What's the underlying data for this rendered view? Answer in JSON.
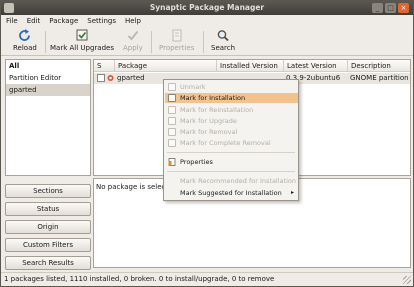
{
  "window": {
    "title": "Synaptic Package Manager",
    "controls": [
      "_",
      "□",
      "×"
    ]
  },
  "menu": [
    "File",
    "Edit",
    "Package",
    "Settings",
    "Help"
  ],
  "toolbar": {
    "reload": "Reload",
    "mark_all": "Mark All Upgrades",
    "apply": "Apply",
    "properties": "Properties",
    "search": "Search"
  },
  "filters": [
    "All",
    "Partition Editor",
    "gparted"
  ],
  "side_buttons": [
    "Sections",
    "Status",
    "Origin",
    "Custom Filters",
    "Search Results"
  ],
  "table": {
    "columns": [
      "S",
      "Package",
      "Installed Version",
      "Latest Version",
      "Description"
    ],
    "rows": [
      {
        "package": "gparted",
        "installed": "",
        "latest": "0.3.9-2ubuntu6",
        "description": "GNOME partition e"
      }
    ]
  },
  "details": {
    "message": "No package is selected."
  },
  "context_menu": {
    "unmark": "Unmark",
    "install": "Mark for Installation",
    "reinstall": "Mark for Reinstallation",
    "upgrade": "Mark for Upgrade",
    "removal": "Mark for Removal",
    "complete_removal": "Mark for Complete Removal",
    "properties": "Properties",
    "recommended": "Mark Recommended for Installation",
    "suggested": "Mark Suggested for Installation"
  },
  "statusbar": {
    "text": "1 packages listed, 1110 installed, 0 broken. 0 to install/upgrade, 0 to remove"
  },
  "colors": {
    "highlight": "#f3c38e",
    "titlebar": "#4b4844",
    "window_bg": "#efebe7"
  }
}
